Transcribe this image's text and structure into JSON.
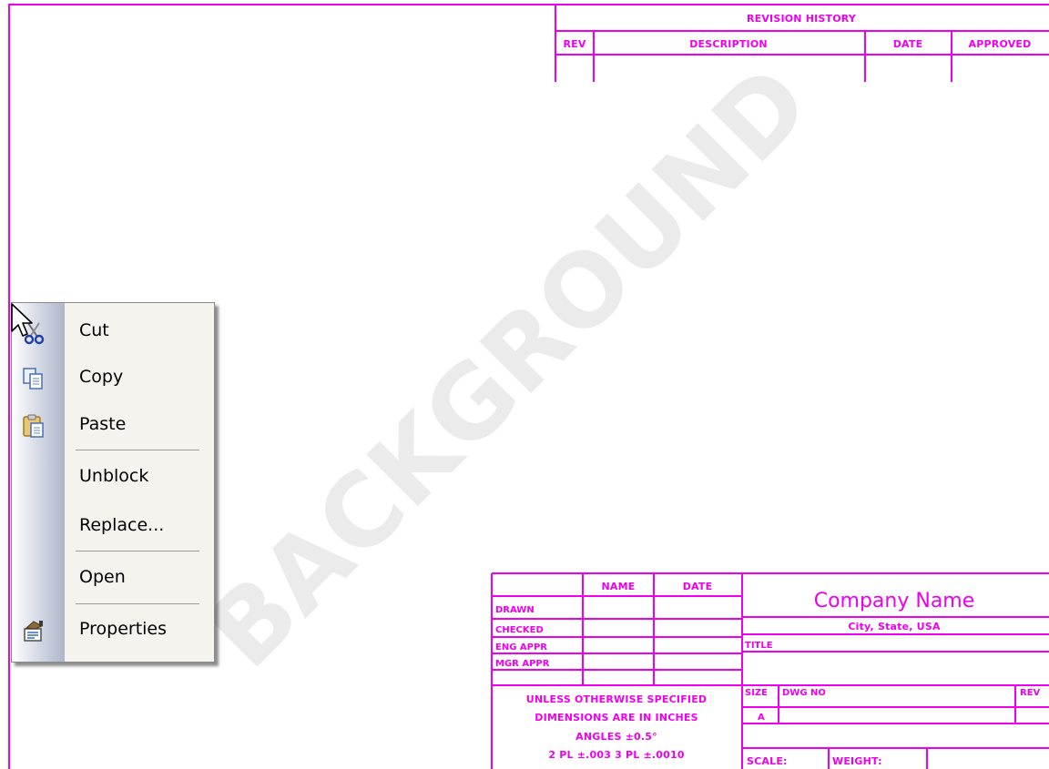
{
  "drawing": {
    "watermark": "BACKGROUND",
    "revision_history": {
      "title": "REVISION HISTORY",
      "columns": [
        "REV",
        "DESCRIPTION",
        "DATE",
        "APPROVED"
      ]
    },
    "approvals": {
      "headers": [
        "NAME",
        "DATE"
      ],
      "rows": [
        "DRAWN",
        "CHECKED",
        "ENG APPR",
        "MGR APPR"
      ]
    },
    "tolerances": [
      "UNLESS OTHERWISE SPECIFIED",
      "DIMENSIONS ARE IN INCHES",
      "ANGLES ±0.5°",
      "2 PL ±.003  3 PL ±.0010"
    ],
    "title_block": {
      "company": "Company Name",
      "address": "City, State, USA",
      "title_label": "TITLE",
      "size_label": "SIZE",
      "size_value": "A",
      "dwg_no_label": "DWG NO",
      "rev_label": "REV",
      "scale_label": "SCALE:",
      "weight_label": "WEIGHT:"
    },
    "line_color": "#ee00ee"
  },
  "context_menu": {
    "items": [
      {
        "label": "Cut",
        "icon": "scissors-icon",
        "enabled": true
      },
      {
        "label": "Copy",
        "icon": "copy-icon",
        "enabled": true
      },
      {
        "label": "Paste",
        "icon": "paste-icon",
        "enabled": true
      },
      {
        "label": "Unblock",
        "icon": "",
        "enabled": true
      },
      {
        "label": "Replace...",
        "icon": "",
        "enabled": true
      },
      {
        "label": "Open",
        "icon": "",
        "enabled": true
      },
      {
        "label": "Properties",
        "icon": "properties-icon",
        "enabled": true
      }
    ]
  }
}
